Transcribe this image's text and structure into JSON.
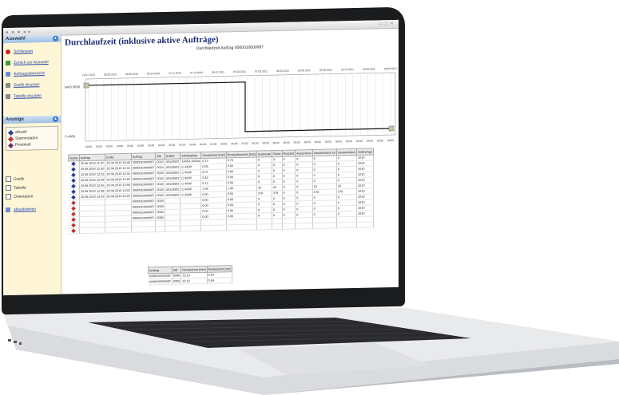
{
  "window": {
    "dots": "● ● ●  ◂ ▸",
    "controls": "▭ ◻ ✕"
  },
  "page_title": "Durchlaufzeit (inklusive aktive Aufträge)",
  "chart": {
    "title": "Durchlaufzeit Auftrag 0000010000087",
    "top_ticks": [
      "16.07.2010",
      "09.08.2010",
      "08.09.2010",
      "08.10.2010",
      "07.11.2010",
      "07.12.2010",
      "06.01.2011",
      "05.02.2011",
      "07.03.2011",
      "06.04.2011",
      "06.05.2011",
      "05.06.2011",
      "05.07.2011",
      "04.08.2011",
      "03.09.2011"
    ],
    "bottom_tick": "00:00",
    "y_top_label": "WAS.6698",
    "y_bottom_label": "C-4600",
    "colors": {
      "line": "#111111",
      "grid": "#d8d8d8"
    }
  },
  "sidebar": {
    "header": "Auswahl",
    "items": [
      {
        "label": "Schliessen",
        "icon": "close-icon"
      },
      {
        "label": "Zurück zur Auswahl",
        "icon": "back-icon"
      },
      {
        "label": "Auftragsübersicht",
        "icon": "list-icon"
      },
      {
        "label": "Grafik drucken",
        "icon": "print-icon"
      },
      {
        "label": "Tabelle drucken",
        "icon": "print-icon"
      }
    ],
    "anzeige_header": "Anzeige",
    "legend": [
      {
        "label": "aktuell",
        "color": "#2b3f8f"
      },
      {
        "label": "Stammdaten",
        "color": "#c23030"
      },
      {
        "label": "Protokoll",
        "color": "#7a2a6a"
      }
    ],
    "checks": [
      {
        "label": "Grafik"
      },
      {
        "label": "Tabelle"
      },
      {
        "label": "Orientation"
      }
    ],
    "refresh_label": "aktualisieren"
  },
  "table": {
    "headers": [
      "Status",
      "Auftrag",
      "Ende",
      "Auftrag",
      "Wk",
      "Artikel",
      "Arbeitsplatz",
      "Gesamtzeit [min]",
      "Produktionszeit [min]",
      "Ausbeute",
      "Stück",
      "Rüstzeit",
      "Ausschuss",
      "Gesamtstück Ist",
      "Gesamtstück",
      "Sollmenge"
    ],
    "rows": [
      {
        "status": "#2b3f8f",
        "cells": [
          "25.06.2010 11:47",
          "25.06.2010 15:48",
          "0000010000087",
          "0010",
          "40110502",
          "14454-1600A",
          "0.73",
          "0.73",
          "0",
          "0",
          "0",
          "0",
          "0",
          "0",
          "1010"
        ]
      },
      {
        "status": "#2b3f8f",
        "cells": [
          "20.09.2010 12:30",
          "20.09.2010 12:33",
          "0000010000087",
          "0010",
          "40110502",
          "C-4600",
          "0.05",
          "0.00",
          "0",
          "0",
          "0",
          "0",
          "0",
          "0",
          "1010"
        ]
      },
      {
        "status": "#2b3f8f",
        "cells": [
          "20.09.2010 12:33",
          "20.09.2010 12:34",
          "0000010000087",
          "0020",
          "40110502",
          "C-4600",
          "0.07",
          "0.00",
          "0",
          "0",
          "0",
          "0",
          "0",
          "0",
          "1010"
        ]
      },
      {
        "status": "#2b3f8f",
        "cells": [
          "20.09.2010 12:39",
          "20.09.2010 12:55",
          "0000010000087",
          "0020",
          "40110502",
          "C-4600",
          "0.42",
          "0.00",
          "0",
          "0",
          "0",
          "0",
          "0",
          "0",
          "1010"
        ]
      },
      {
        "status": "#2b3f8f",
        "cells": [
          "20.09.2010 12:55",
          "20.09.2010 12:58",
          "0000010000087",
          "0020",
          "40110502",
          "C-4600",
          "0.12",
          "0.00",
          "0",
          "0",
          "0",
          "0",
          "0",
          "0",
          "1010"
        ]
      },
      {
        "status": "#2b3f8f",
        "cells": [
          "20.09.2010 12:58",
          "20.09.2010 13:03",
          "0000010000087",
          "0020",
          "40110502",
          "C-4600",
          "1.08",
          "1.06",
          "43",
          "43",
          "0",
          "0",
          "43",
          "43",
          "1010"
        ]
      },
      {
        "status": "#2b3f8f",
        "cells": [
          "20.09.2010 13:03",
          "20.09.2010 13:20",
          "0000010000087",
          "0020",
          "40110502",
          "C-4600",
          "0.60",
          "0.50",
          "378",
          "378",
          "0",
          "0",
          "378",
          "378",
          "1010"
        ]
      },
      {
        "status": "#c23030",
        "cells": [
          "",
          "",
          "0000010000087",
          "0025",
          "",
          "",
          "0.00",
          "0.00",
          "0",
          "0",
          "0",
          "0",
          "0",
          "0",
          "1010"
        ]
      },
      {
        "status": "#c23030",
        "cells": [
          "",
          "",
          "0000010000087",
          "0030",
          "",
          "",
          "0.00",
          "0.00",
          "0",
          "0",
          "0",
          "0",
          "0",
          "0",
          "1010"
        ]
      },
      {
        "status": "#c23030",
        "cells": [
          "",
          "",
          "0000010000087",
          "0040",
          "",
          "",
          "0.00",
          "0.00",
          "0",
          "0",
          "0",
          "0",
          "0",
          "0",
          "1010"
        ]
      },
      {
        "status": "#c23030",
        "cells": [
          "",
          "",
          "0000010000087",
          "0050",
          "",
          "",
          "0.00",
          "0.00",
          "0",
          "0",
          "0",
          "0",
          "0",
          "0",
          "1010"
        ]
      },
      {
        "status": "#c23030",
        "cells": [
          "",
          "",
          "",
          "",
          "",
          "",
          "",
          "",
          "",
          "",
          "",
          "",
          "",
          "",
          ""
        ]
      },
      {
        "status": "#c23030",
        "cells": [
          "",
          "",
          "",
          "",
          "",
          "",
          "",
          "",
          "",
          "",
          "",
          "",
          "",
          "",
          ""
        ]
      }
    ]
  },
  "summary": {
    "headers": [
      "Auftrag",
      "Wk",
      "Restlaufzeit [min]",
      "Restlaufzeit [std]"
    ],
    "rows": [
      [
        "0000010000087",
        "0040",
        "32.16",
        "0.54"
      ],
      [
        "0000010000087",
        "0050",
        "32.16",
        "0.54"
      ]
    ]
  }
}
